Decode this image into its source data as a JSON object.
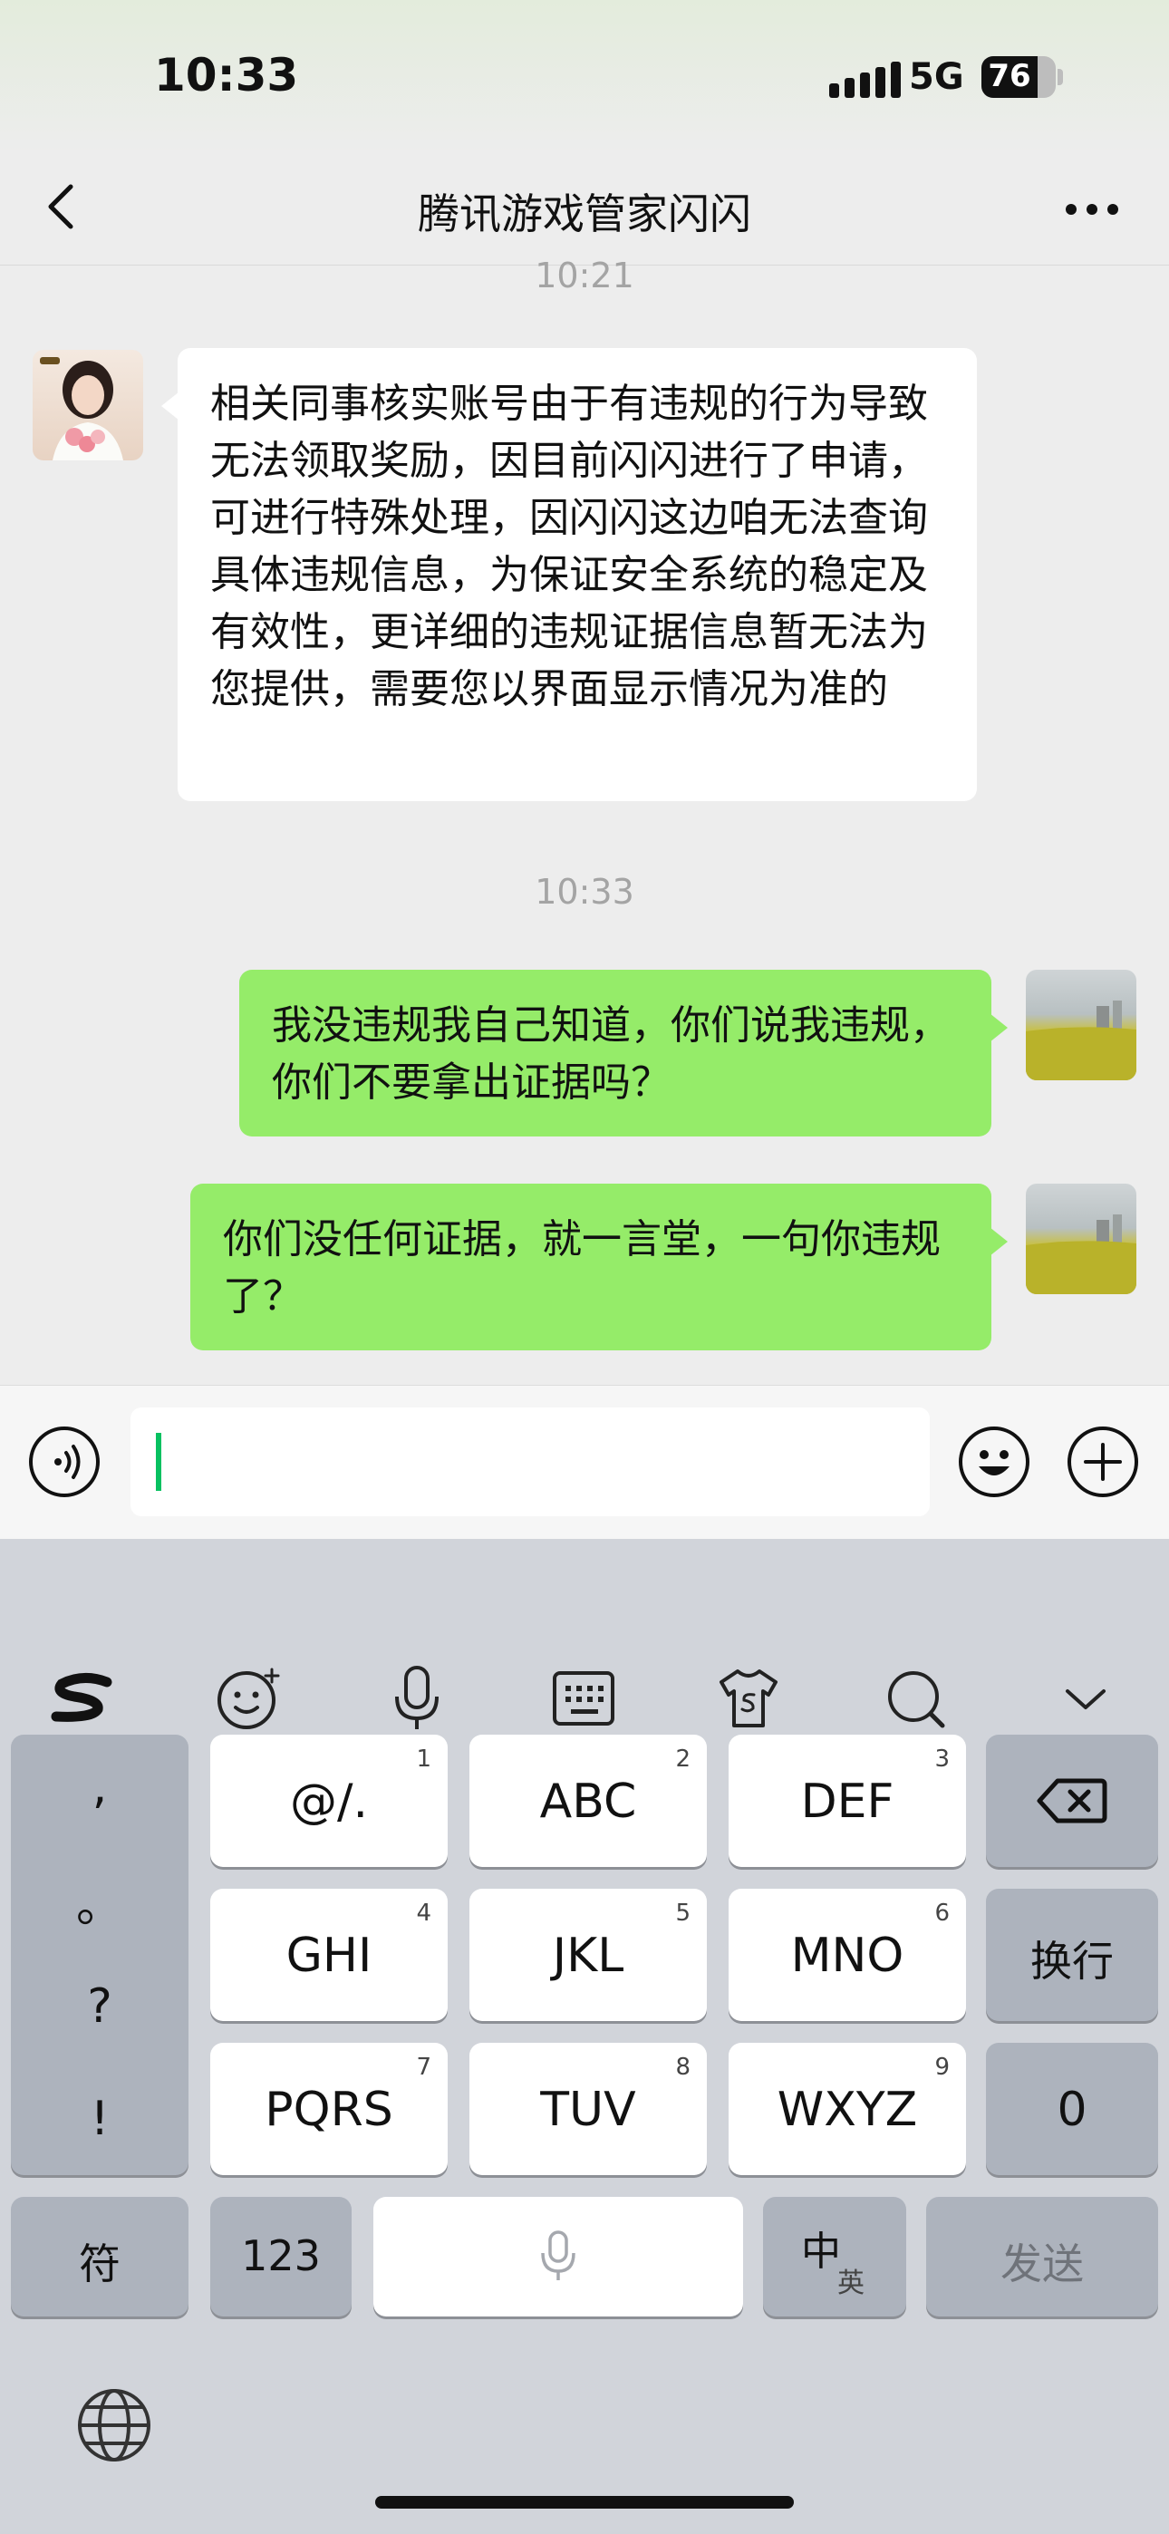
{
  "status": {
    "time": "10:33",
    "network": "5G",
    "battery": "76",
    "battery_level": 0.76
  },
  "nav": {
    "title": "腾讯游戏管家闪闪",
    "back_icon": "chevron-left-icon",
    "more_icon": "more-icon"
  },
  "chat": {
    "timestamp_top": "10:21",
    "incoming_text": "相关同事核实账号由于有违规的行为导致无法领取奖励，因目前闪闪进行了申请，可进行特殊处理，因闪闪这边咱无法查询具体违规信息，为保证安全系统的稳定及有效性，更详细的违规证据信息暂无法为您提供，需要您以界面显示情况为准的",
    "timestamp_mid": "10:33",
    "outgoing_1": "我没违规我自己知道，你们说我违规，你们不要拿出证据吗？",
    "outgoing_2": "你们没任何证据，就一言堂，一句你违规了？"
  },
  "inputbar": {
    "voice_icon": "voice-icon",
    "emoji_icon": "emoji-icon",
    "plus_icon": "plus-icon"
  },
  "keyboard": {
    "toolbar": [
      "sogou-logo-icon",
      "emoji-icon",
      "microphone-icon",
      "keyboard-icon",
      "skin-icon",
      "search-icon",
      "chevron-down-icon"
    ],
    "punct": [
      ",",
      "。",
      "?",
      "!"
    ],
    "keys": [
      {
        "label": "@/.",
        "num": "1"
      },
      {
        "label": "ABC",
        "num": "2"
      },
      {
        "label": "DEF",
        "num": "3"
      },
      {
        "label": "GHI",
        "num": "4"
      },
      {
        "label": "JKL",
        "num": "5"
      },
      {
        "label": "MNO",
        "num": "6"
      },
      {
        "label": "PQRS",
        "num": "7"
      },
      {
        "label": "TUV",
        "num": "8"
      },
      {
        "label": "WXYZ",
        "num": "9"
      }
    ],
    "newline": "换行",
    "zero": "0",
    "symbol": "符",
    "numeric": "123",
    "zh_main": "中",
    "zh_sub": "英",
    "send": "发送"
  }
}
